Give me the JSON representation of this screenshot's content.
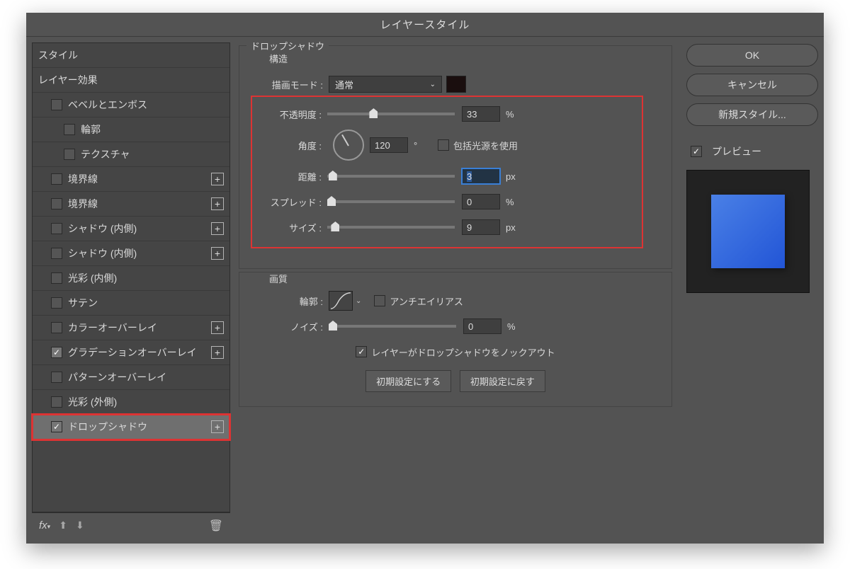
{
  "title": "レイヤースタイル",
  "left": {
    "styles": "スタイル",
    "blending": "レイヤー効果",
    "items": [
      {
        "label": "ベベルとエンボス",
        "checked": false,
        "plus": false,
        "indent": 1
      },
      {
        "label": "輪郭",
        "checked": false,
        "plus": false,
        "indent": 2
      },
      {
        "label": "テクスチャ",
        "checked": false,
        "plus": false,
        "indent": 2
      },
      {
        "label": "境界線",
        "checked": false,
        "plus": true,
        "indent": 1
      },
      {
        "label": "境界線",
        "checked": false,
        "plus": true,
        "indent": 1
      },
      {
        "label": "シャドウ (内側)",
        "checked": false,
        "plus": true,
        "indent": 1
      },
      {
        "label": "シャドウ (内側)",
        "checked": false,
        "plus": true,
        "indent": 1
      },
      {
        "label": "光彩 (内側)",
        "checked": false,
        "plus": false,
        "indent": 1
      },
      {
        "label": "サテン",
        "checked": false,
        "plus": false,
        "indent": 1
      },
      {
        "label": "カラーオーバーレイ",
        "checked": false,
        "plus": true,
        "indent": 1
      },
      {
        "label": "グラデーションオーバーレイ",
        "checked": true,
        "plus": true,
        "indent": 1
      },
      {
        "label": "パターンオーバーレイ",
        "checked": false,
        "plus": false,
        "indent": 1
      },
      {
        "label": "光彩 (外側)",
        "checked": false,
        "plus": false,
        "indent": 1
      },
      {
        "label": "ドロップシャドウ",
        "checked": true,
        "plus": true,
        "indent": 1,
        "selected": true,
        "highlight": true
      }
    ]
  },
  "center": {
    "heading": "ドロップシャドウ",
    "structure": "構造",
    "blend_mode_label": "描画モード :",
    "blend_mode_value": "通常",
    "opacity_label": "不透明度 :",
    "opacity_value": "33",
    "opacity_unit": "%",
    "angle_label": "角度 :",
    "angle_value": "120",
    "angle_unit": "°",
    "global_light": "包括光源を使用",
    "distance_label": "距離 :",
    "distance_value": "3",
    "distance_unit": "px",
    "spread_label": "スプレッド :",
    "spread_value": "0",
    "spread_unit": "%",
    "size_label": "サイズ :",
    "size_value": "9",
    "size_unit": "px",
    "quality": "画質",
    "contour_label": "輪郭 :",
    "antialias": "アンチエイリアス",
    "noise_label": "ノイズ :",
    "noise_value": "0",
    "noise_unit": "%",
    "knockout": "レイヤーがドロップシャドウをノックアウト",
    "make_default": "初期設定にする",
    "reset_default": "初期設定に戻す"
  },
  "right": {
    "ok": "OK",
    "cancel": "キャンセル",
    "new_style": "新規スタイル...",
    "preview": "プレビュー"
  }
}
